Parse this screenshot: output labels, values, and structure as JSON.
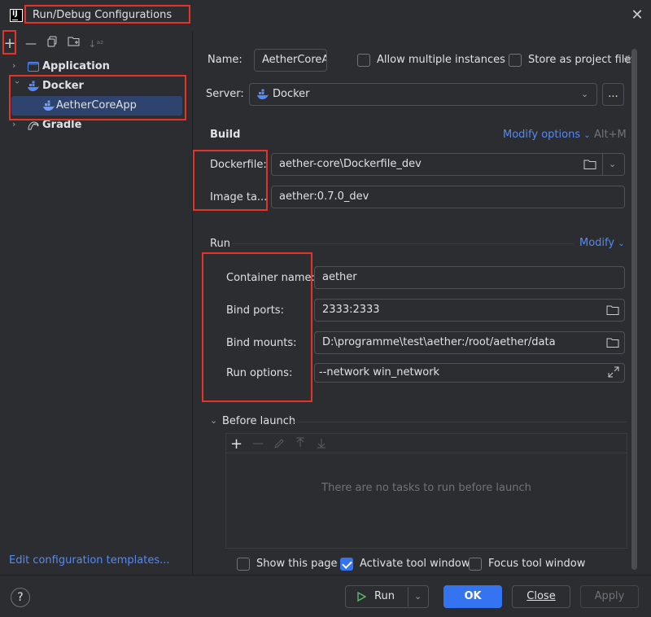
{
  "window": {
    "title": "Run/Debug Configurations",
    "logo": "IJ"
  },
  "toolbar": {
    "add_icon": "+",
    "remove_icon": "—",
    "copy_icon": "copy-icon",
    "folder_icon": "new-folder-icon",
    "sort_icon": "↓ᵃᶻ"
  },
  "tree": {
    "items": [
      {
        "label": "Application",
        "icon": "application-icon"
      },
      {
        "label": "Docker",
        "icon": "docker-icon"
      },
      {
        "label": "AetherCoreApp",
        "icon": "docker-icon"
      },
      {
        "label": "Gradle",
        "icon": "gradle-icon"
      }
    ]
  },
  "edit_templates": "Edit configuration templates...",
  "form": {
    "name_label": "Name:",
    "name_value": "AetherCoreA",
    "allow_multiple": "Allow multiple instances",
    "store_project": "Store as project file",
    "server_label": "Server:",
    "server_value": "Docker",
    "server_more": "...",
    "build_title": "Build",
    "modify_options": "Modify options",
    "modify_shortcut": "Alt+M",
    "dockerfile_label": "Dockerfile:",
    "dockerfile_value": "aether-core\\Dockerfile_dev",
    "imagetag_label": "Image ta...",
    "imagetag_value": "aether:0.7.0_dev",
    "run_title": "Run",
    "modify": "Modify",
    "container_label": "Container name:",
    "container_value": "aether",
    "ports_label": "Bind ports:",
    "ports_value": "2333:2333",
    "mounts_label": "Bind mounts:",
    "mounts_value": "D:\\programme\\test\\aether:/root/aether/data",
    "runopts_label": "Run options:",
    "runopts_value": "--network win_network",
    "before_launch": "Before launch",
    "no_tasks": "There are no tasks to run before launch",
    "show_page": "Show this page",
    "activate_tool": "Activate tool window",
    "focus_tool": "Focus tool window"
  },
  "footer": {
    "help": "?",
    "run": "Run",
    "ok": "OK",
    "close": "Close",
    "apply": "Apply"
  },
  "colors": {
    "accent": "#3574f0",
    "link": "#548af7",
    "highlight": "#e5332a",
    "background": "#2b2d30"
  }
}
